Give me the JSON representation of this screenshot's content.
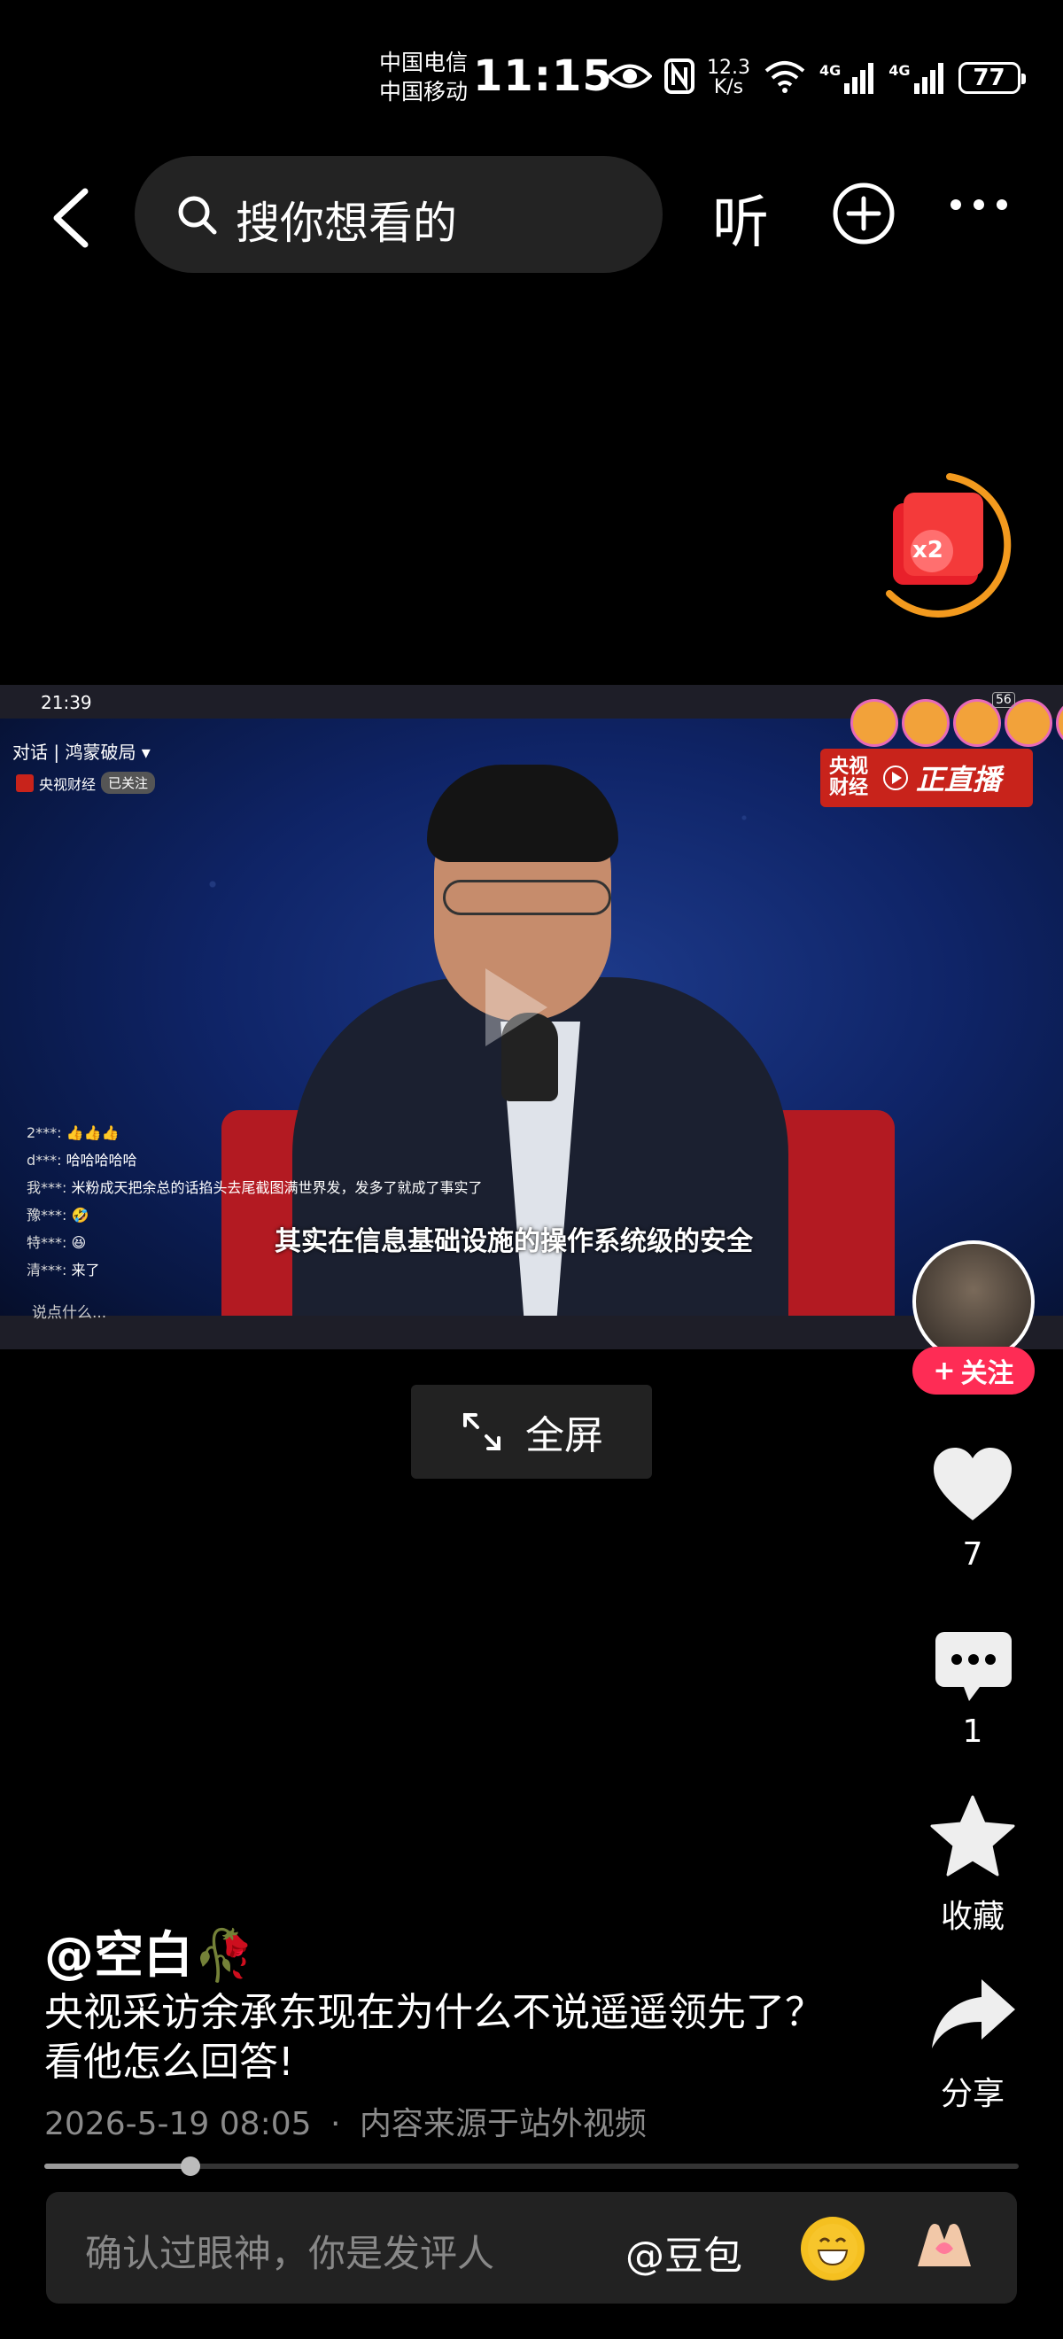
{
  "status_bar": {
    "carrier1": "中国电信",
    "carrier2": "中国移动",
    "time": "11:15",
    "net_speed_value": "12.3",
    "net_speed_unit": "K/s",
    "signal1": "4G",
    "signal2": "4G",
    "battery": "77"
  },
  "top_bar": {
    "search_placeholder": "搜你想看的",
    "listen_label": "听"
  },
  "red_packet": {
    "multiplier": "x2"
  },
  "video": {
    "overlay_time": "21:39",
    "overlay_title": "对话 | 鸿蒙破局 ▾",
    "overlay_channel": "央视财经",
    "overlay_followed": "已关注",
    "live_channel_line1": "央视",
    "live_channel_line2": "财经",
    "live_label": "正直播",
    "viewer_count": "56",
    "subtitle": "其实在信息基础设施的操作系统级的安全",
    "say_something": "说点什么...",
    "live_comments": [
      {
        "user": "2***:",
        "text": "👍👍👍"
      },
      {
        "user": "d***:",
        "text": "哈哈哈哈哈"
      },
      {
        "user": "我***:",
        "text": "米粉成天把余总的话掐头去尾截图满世界发，发多了就成了事实了"
      },
      {
        "user": "豫***:",
        "text": "🤣"
      },
      {
        "user": "特***:",
        "text": "😆"
      },
      {
        "user": "清***:",
        "text": "来了"
      }
    ]
  },
  "fullscreen_label": "全屏",
  "side_actions": {
    "follow_label": "关注",
    "like_count": "7",
    "comment_count": "1",
    "favorite_label": "收藏",
    "share_label": "分享"
  },
  "post": {
    "author": "@空白🥀",
    "caption": "央视采访余承东现在为什么不说遥遥领先了？看他怎么回答!",
    "date": "2026-5-19 08:05",
    "source": "内容来源于站外视频",
    "progress": 0.15
  },
  "comment_bar": {
    "placeholder": "确认过眼神，你是发评人",
    "mention": "@豆包",
    "emoji1": "😁",
    "emoji2": "🫶"
  }
}
